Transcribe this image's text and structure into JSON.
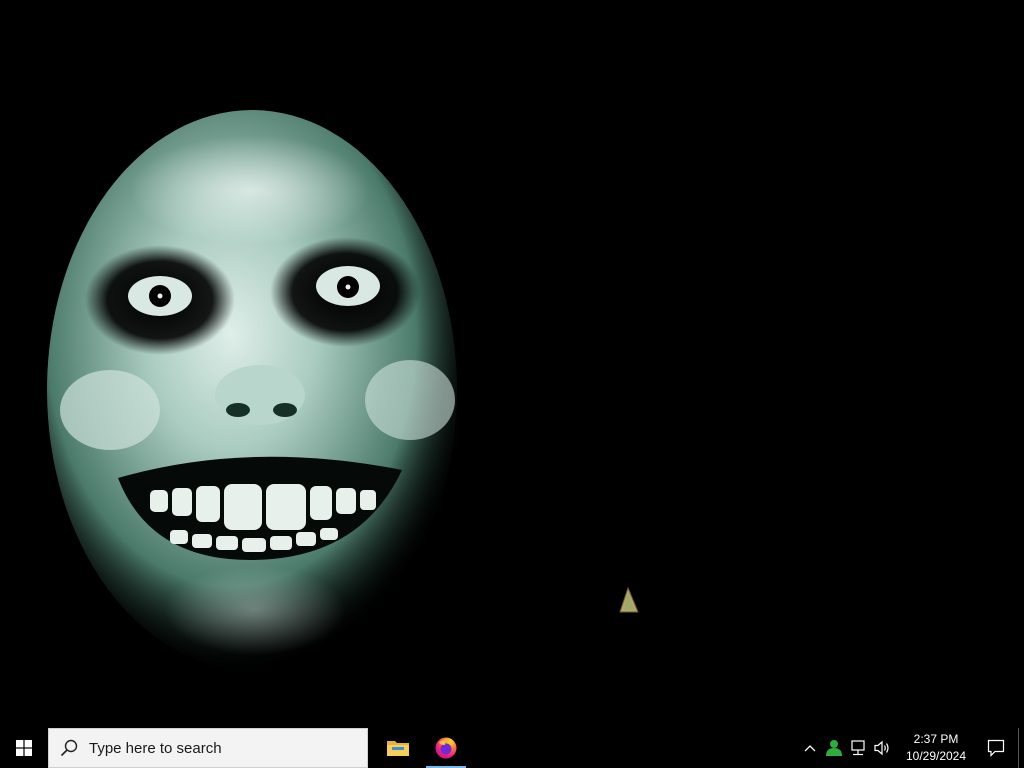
{
  "desktop": {
    "wallpaper_icon": "smiling-face-wallpaper"
  },
  "taskbar": {
    "start_icon": "windows-logo-icon",
    "search": {
      "placeholder": "Type here to search",
      "icon": "search-icon"
    },
    "pinned": [
      {
        "name": "file-explorer",
        "icon": "folder-icon",
        "active": false
      },
      {
        "name": "firefox",
        "icon": "firefox-icon",
        "active": true
      }
    ],
    "tray": {
      "chevron_icon": "chevron-up-icon",
      "user_icon": "person-icon",
      "network_icon": "network-icon",
      "volume_icon": "speaker-icon"
    },
    "clock": {
      "time": "2:37 PM",
      "date": "10/29/2024"
    },
    "notification_icon": "action-center-icon",
    "colors": {
      "background": "#000000",
      "search_bg": "#f3f3f3",
      "active_indicator": "#76b9ed"
    }
  }
}
